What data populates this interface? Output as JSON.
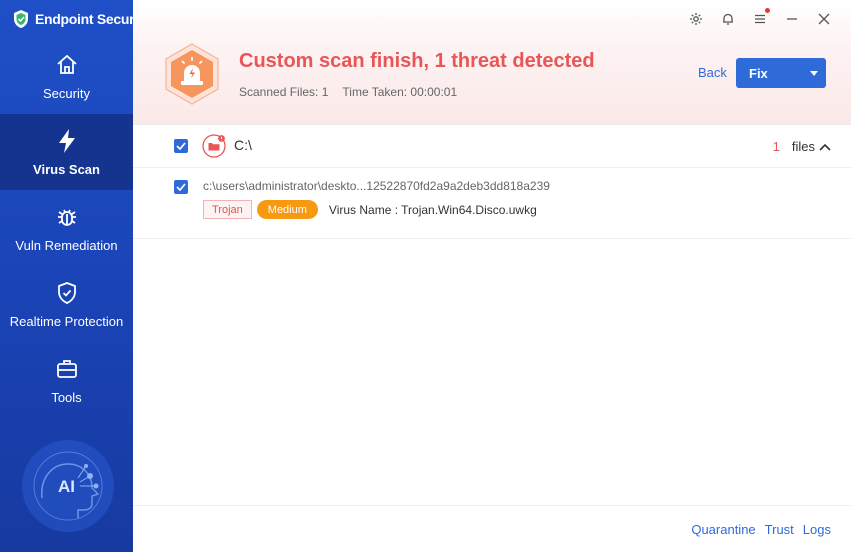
{
  "app": {
    "brand": "Endpoint Secure"
  },
  "sidebar": {
    "items": [
      {
        "label": "Security",
        "icon": "home-icon",
        "active": false
      },
      {
        "label": "Virus Scan",
        "icon": "lightning-icon",
        "active": true
      },
      {
        "label": "Vuln Remediation",
        "icon": "bug-icon",
        "active": false
      },
      {
        "label": "Realtime Protection",
        "icon": "shield-check-icon",
        "active": false
      },
      {
        "label": "Tools",
        "icon": "toolbox-icon",
        "active": false
      }
    ],
    "ai_label": "AI"
  },
  "header": {
    "title": "Custom scan finish, 1 threat detected",
    "scanned_files": "Scanned Files: 1",
    "time_taken": "Time Taken: 00:00:01",
    "back_label": "Back",
    "fix_label": "Fix"
  },
  "results": {
    "group": {
      "drive": "C:\\",
      "count": "1",
      "count_unit": "files"
    },
    "items": [
      {
        "path": "c:\\users\\administrator\\deskto...12522870fd2a9a2deb3dd818a239",
        "type_tag": "Trojan",
        "severity": "Medium",
        "virus_name": "Virus Name : Trojan.Win64.Disco.uwkg"
      }
    ]
  },
  "footer": {
    "quarantine": "Quarantine",
    "trust": "Trust",
    "logs": "Logs"
  },
  "colors": {
    "accent": "#2f6bd8",
    "sidebar": "#1f4fc7",
    "danger": "#e85656",
    "warning": "#f79a12"
  }
}
